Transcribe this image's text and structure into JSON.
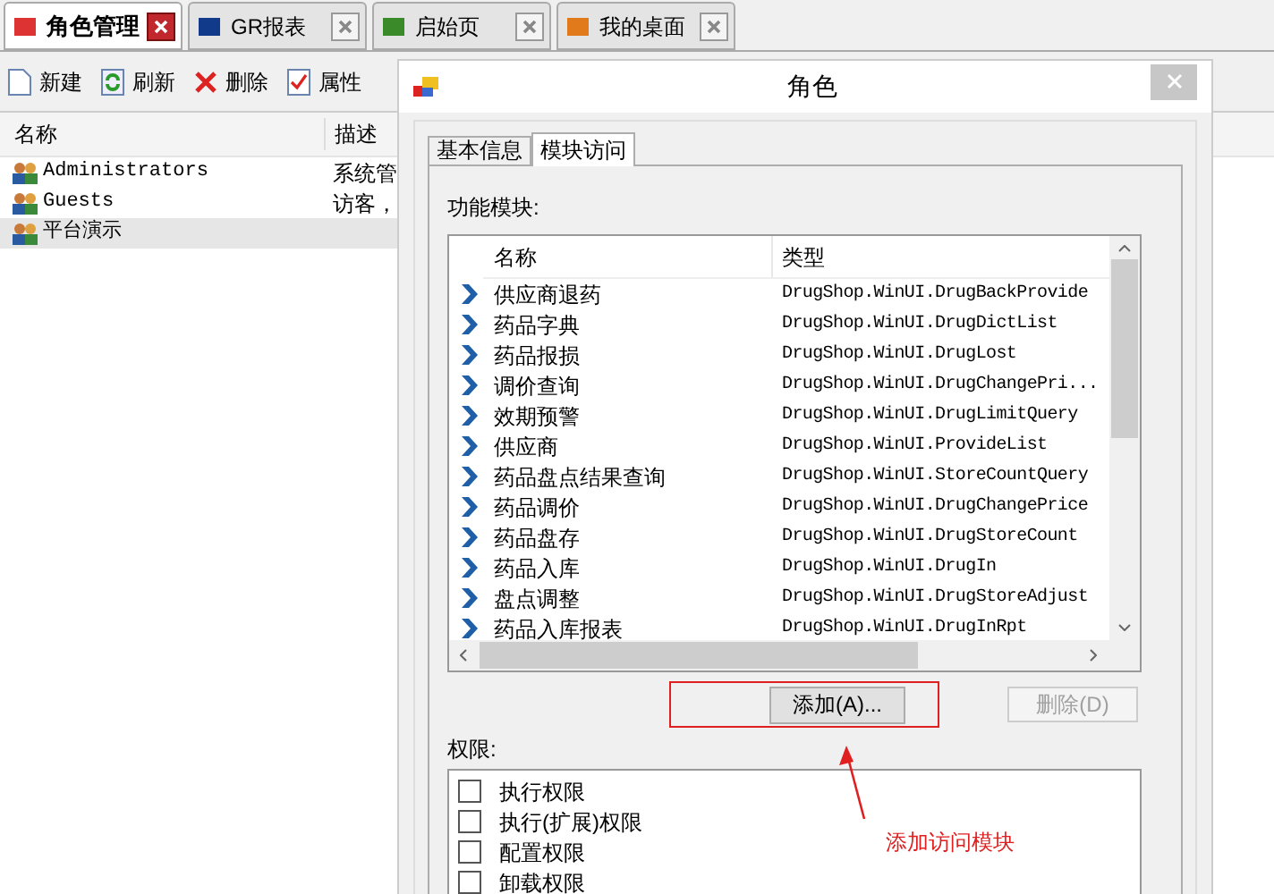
{
  "doc_tabs": [
    {
      "label": "角色管理",
      "selected": true
    },
    {
      "label": "GR报表",
      "selected": false
    },
    {
      "label": "启始页",
      "selected": false
    },
    {
      "label": "我的桌面",
      "selected": false
    }
  ],
  "toolbar": [
    "新建",
    "刷新",
    "删除",
    "属性"
  ],
  "role_list": {
    "columns": [
      "名称",
      "描述"
    ],
    "rows": [
      {
        "name": "Administrators",
        "description": "系统管",
        "selected": false
      },
      {
        "name": "Guests",
        "description": "访客，",
        "selected": false
      },
      {
        "name": "平台演示",
        "selected": true
      }
    ]
  },
  "dialog": {
    "title": "角色",
    "tabs": [
      {
        "label": "基本信息",
        "selected": false
      },
      {
        "label": "模块访问",
        "selected": true
      }
    ],
    "modules_label": "功能模块:",
    "columns": [
      "名称",
      "类型"
    ],
    "rows": [
      {
        "name": "供应商退药",
        "type": "DrugShop.WinUI.DrugBackProvide"
      },
      {
        "name": "药品字典",
        "type": "DrugShop.WinUI.DrugDictList"
      },
      {
        "name": "药品报损",
        "type": "DrugShop.WinUI.DrugLost"
      },
      {
        "name": "调价查询",
        "type": "DrugShop.WinUI.DrugChangePri..."
      },
      {
        "name": "效期预警",
        "type": "DrugShop.WinUI.DrugLimitQuery"
      },
      {
        "name": "供应商",
        "type": "DrugShop.WinUI.ProvideList"
      },
      {
        "name": "药品盘点结果查询",
        "type": "DrugShop.WinUI.StoreCountQuery"
      },
      {
        "name": "药品调价",
        "type": "DrugShop.WinUI.DrugChangePrice"
      },
      {
        "name": "药品盘存",
        "type": "DrugShop.WinUI.DrugStoreCount"
      },
      {
        "name": "药品入库",
        "type": "DrugShop.WinUI.DrugIn"
      },
      {
        "name": "盘点调整",
        "type": "DrugShop.WinUI.DrugStoreAdjust"
      },
      {
        "name": "药品入库报表",
        "type": "DrugShop.WinUI.DrugInRpt"
      }
    ],
    "add_button": {
      "label": "添加(A)..."
    },
    "delete_button": {
      "label": "删除(D)",
      "disabled": true
    },
    "permissions_label": "权限:",
    "permissions": [
      {
        "label": "执行权限",
        "checked": false
      },
      {
        "label": "执行(扩展)权限",
        "checked": false
      },
      {
        "label": "配置权限",
        "checked": false
      },
      {
        "label": "卸载权限",
        "checked": false
      }
    ]
  },
  "annotation": "添加访问模块"
}
